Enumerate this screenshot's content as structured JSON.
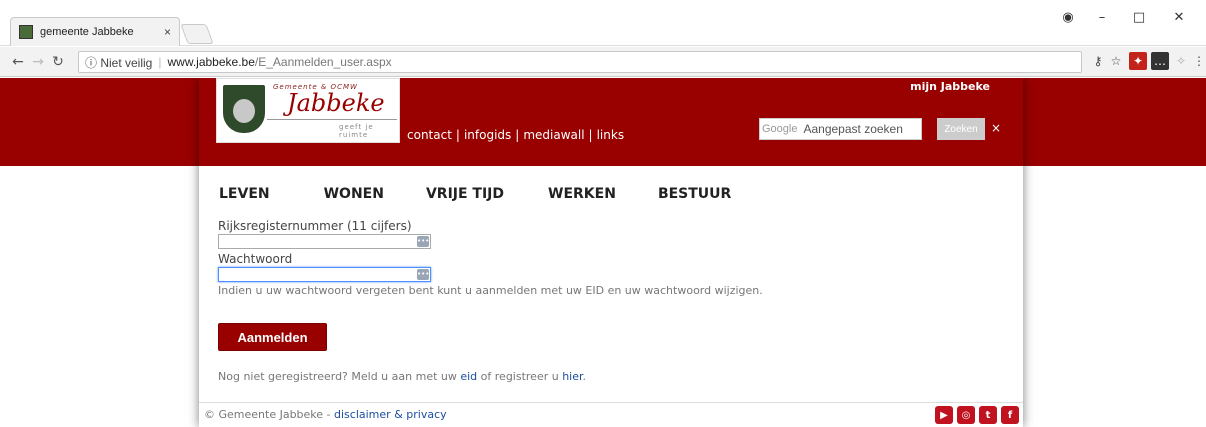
{
  "browser": {
    "tab_title": "gemeente Jabbeke",
    "tab_close": "×",
    "security_label": "ⓘ Niet veilig",
    "url_host": "www.jabbeke.be",
    "url_path": "/E_Aanmelden_user.aspx"
  },
  "header": {
    "logo": {
      "org": "Gemeente & OCMW",
      "name": "Jabbeke",
      "tagline": "geeft je ruimte"
    },
    "top_links": [
      "contact",
      "infogids",
      "mediawall",
      "links"
    ],
    "link_separator": "|",
    "mijn": "mijn Jabbeke",
    "search": {
      "brand": "Google",
      "placeholder": "Aangepast zoeken",
      "button": "Zoeken",
      "clear": "×"
    }
  },
  "menu": [
    "LEVEN",
    "WONEN",
    "VRIJE TIJD",
    "WERKEN",
    "BESTUUR"
  ],
  "form": {
    "rrn_label": "Rijksregisternummer (11 cijfers)",
    "rrn_value": "",
    "password_label": "Wachtwoord",
    "password_value": "",
    "hint": "Indien u uw wachtwoord vergeten bent kunt u aanmelden met uw EID en uw wachtwoord wijzigen.",
    "submit": "Aanmelden",
    "register_prefix": "Nog niet geregistreerd? Meld u aan met uw ",
    "eid_link": "eid",
    "register_middle": " of registreer u ",
    "hier_link": "hier",
    "register_suffix": "."
  },
  "footer": {
    "copyright": "© Gemeente Jabbeke - ",
    "disclaimer": "disclaimer & privacy",
    "social": [
      "youtube-icon",
      "instagram-icon",
      "twitter-icon",
      "facebook-icon"
    ]
  },
  "colors": {
    "brand": "#990000",
    "link": "#1a4d9f"
  }
}
